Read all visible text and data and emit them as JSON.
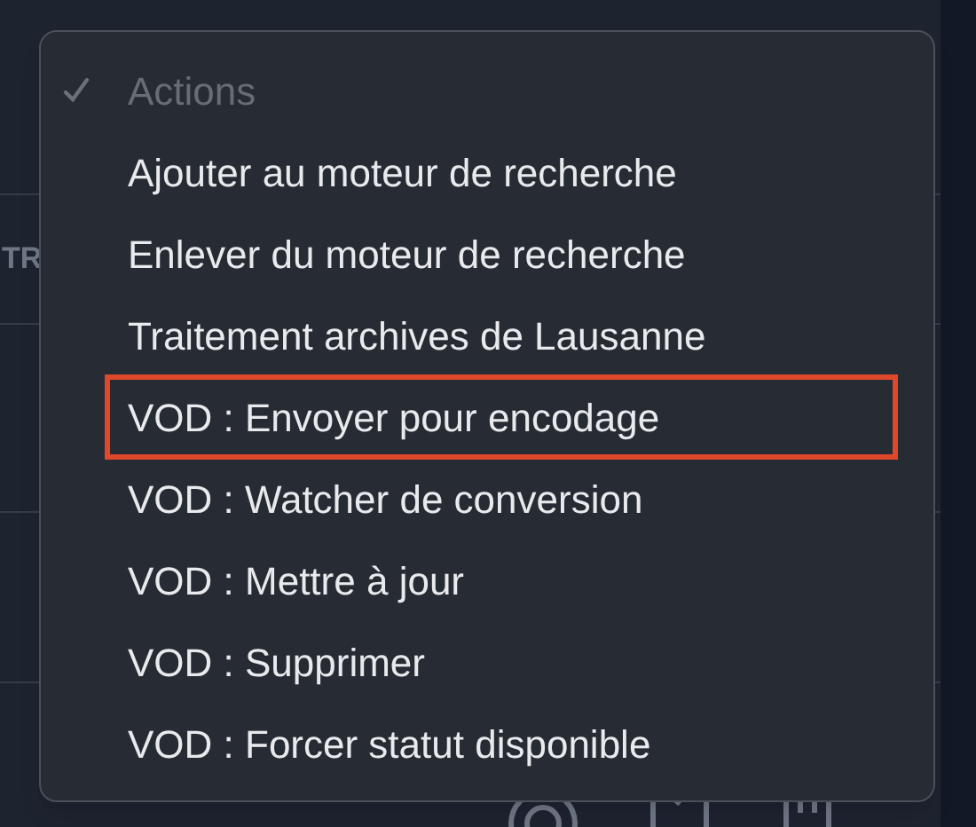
{
  "background": {
    "column_header": "TR"
  },
  "menu": {
    "items": [
      {
        "label": "Actions",
        "checked": true,
        "disabled": true,
        "highlighted": false
      },
      {
        "label": "Ajouter au moteur de recherche",
        "checked": false,
        "disabled": false,
        "highlighted": false
      },
      {
        "label": "Enlever du moteur de recherche",
        "checked": false,
        "disabled": false,
        "highlighted": false
      },
      {
        "label": "Traitement archives de Lausanne",
        "checked": false,
        "disabled": false,
        "highlighted": false
      },
      {
        "label": "VOD : Envoyer pour encodage",
        "checked": false,
        "disabled": false,
        "highlighted": true
      },
      {
        "label": "VOD : Watcher de conversion",
        "checked": false,
        "disabled": false,
        "highlighted": false
      },
      {
        "label": "VOD : Mettre à jour",
        "checked": false,
        "disabled": false,
        "highlighted": false
      },
      {
        "label": "VOD : Supprimer",
        "checked": false,
        "disabled": false,
        "highlighted": false
      },
      {
        "label": "VOD : Forcer statut disponible",
        "checked": false,
        "disabled": false,
        "highlighted": false
      }
    ]
  }
}
